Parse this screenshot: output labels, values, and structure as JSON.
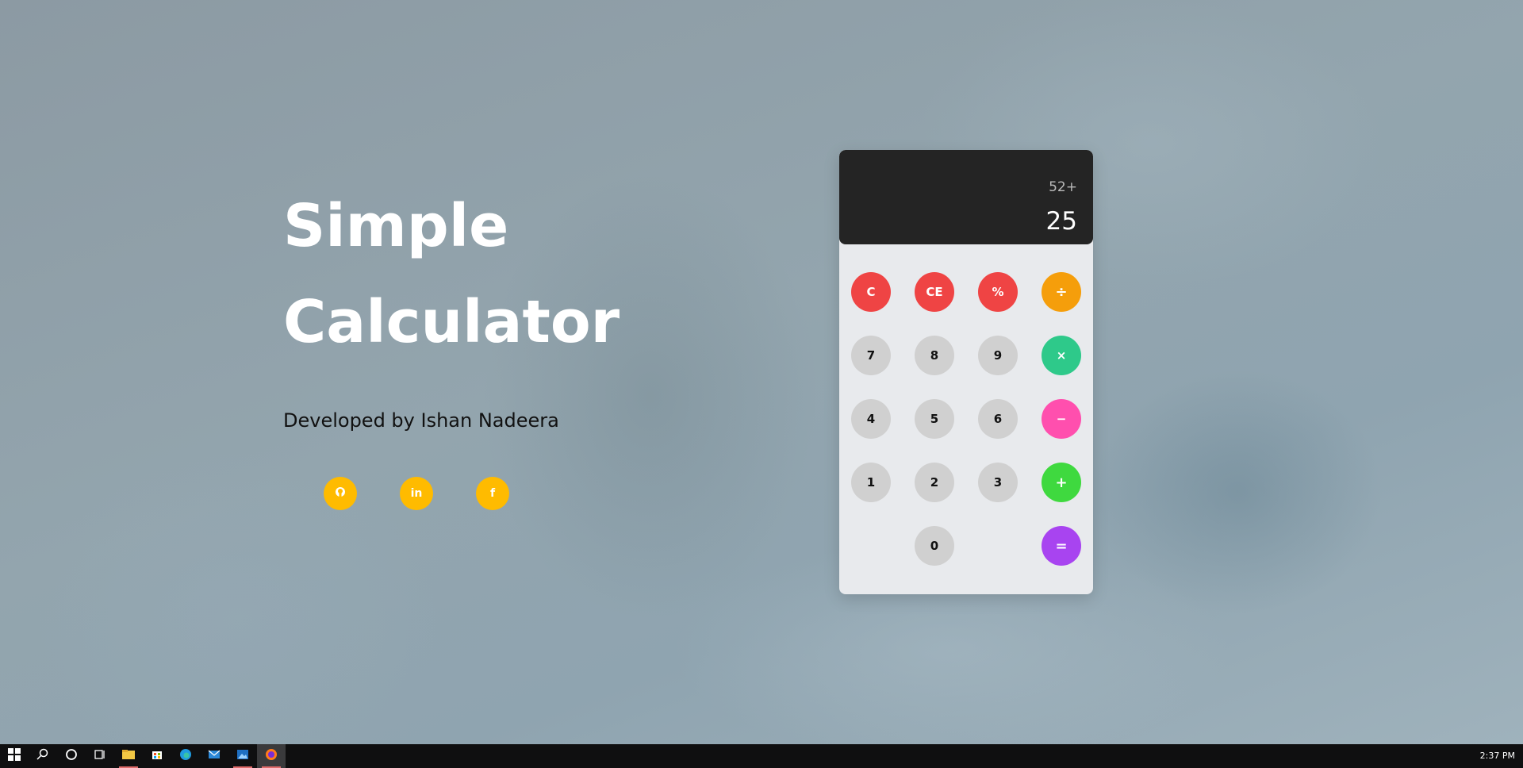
{
  "hero": {
    "title_line1": "Simple",
    "title_line2": "Calculator",
    "credit": "Developed by Ishan Nadeera"
  },
  "socials": [
    {
      "icon": "github-icon",
      "glyph": "●"
    },
    {
      "icon": "linkedin-icon",
      "glyph": "in"
    },
    {
      "icon": "facebook-icon",
      "glyph": "f"
    }
  ],
  "calculator": {
    "previous_operand": "52+",
    "current_operand": "25",
    "keys": {
      "clear": "C",
      "clear_entry": "CE",
      "percent": "%",
      "divide": "÷",
      "seven": "7",
      "eight": "8",
      "nine": "9",
      "multiply": "×",
      "four": "4",
      "five": "5",
      "six": "6",
      "subtract": "−",
      "one": "1",
      "two": "2",
      "three": "3",
      "add": "+",
      "zero": "0",
      "equals": "="
    }
  },
  "taskbar": {
    "clock": "2:37 PM"
  },
  "colors": {
    "accent_yellow": "#ffbb00",
    "key_red": "#ef4444",
    "key_orange": "#f59e0b",
    "key_teal": "#2ec98a",
    "key_pink": "#ff4fae",
    "key_green": "#3fd93f",
    "key_purple": "#a844f0"
  }
}
